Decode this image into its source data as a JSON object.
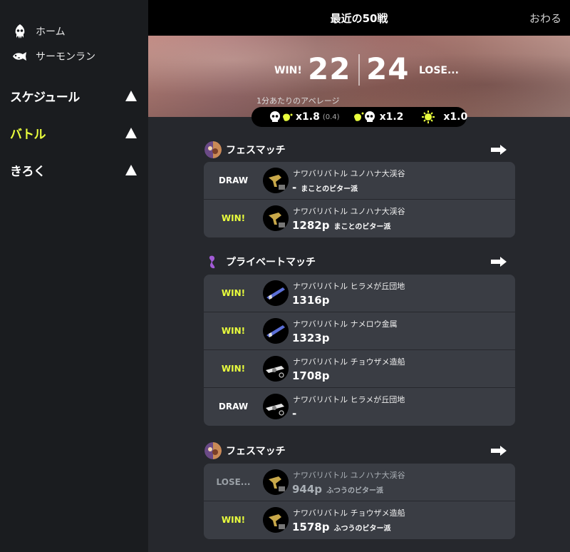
{
  "sidebar": {
    "home": "ホーム",
    "salmon": "サーモンラン",
    "sections": [
      {
        "label": "スケジュール",
        "active": false
      },
      {
        "label": "バトル",
        "active": true
      },
      {
        "label": "きろく",
        "active": false
      }
    ]
  },
  "header": {
    "title": "最近の50戦",
    "close": "おわる"
  },
  "summary": {
    "win_label": "WIN!",
    "win_count": "22",
    "lose_count": "24",
    "lose_label": "LOSE...",
    "avg_label": "1分あたりのアベレージ",
    "kills": "x1.8",
    "assists": "(0.4)",
    "deaths": "x1.2",
    "specials": "x1.0"
  },
  "groups": [
    {
      "name": "フェスマッチ",
      "icon": "splatfest-icon",
      "rows": [
        {
          "result": "DRAW",
          "mode": "ナワバリバトル ユノハナ大渓谷",
          "points": "-",
          "title": "まことのビター派"
        },
        {
          "result": "WIN!",
          "mode": "ナワバリバトル ユノハナ大渓谷",
          "points": "1282p",
          "title": "まことのビター派"
        }
      ]
    },
    {
      "name": "プライベートマッチ",
      "icon": "private-battle-icon",
      "rows": [
        {
          "result": "WIN!",
          "mode": "ナワバリバトル ヒラメが丘団地",
          "points": "1316p",
          "title": ""
        },
        {
          "result": "WIN!",
          "mode": "ナワバリバトル ナメロウ金属",
          "points": "1323p",
          "title": ""
        },
        {
          "result": "WIN!",
          "mode": "ナワバリバトル チョウザメ造船",
          "points": "1708p",
          "title": ""
        },
        {
          "result": "DRAW",
          "mode": "ナワバリバトル ヒラメが丘団地",
          "points": "-",
          "title": ""
        }
      ]
    },
    {
      "name": "フェスマッチ",
      "icon": "splatfest-icon",
      "rows": [
        {
          "result": "LOSE...",
          "mode": "ナワバリバトル ユノハナ大渓谷",
          "points": "944p",
          "title": "ふつうのビター派"
        },
        {
          "result": "WIN!",
          "mode": "ナワバリバトル チョウザメ造船",
          "points": "1578p",
          "title": "ふつうのビター派"
        }
      ]
    }
  ],
  "colors": {
    "accent": "#eaff3d",
    "card": "#3a3d44",
    "sidebar": "#1a1c1f"
  }
}
